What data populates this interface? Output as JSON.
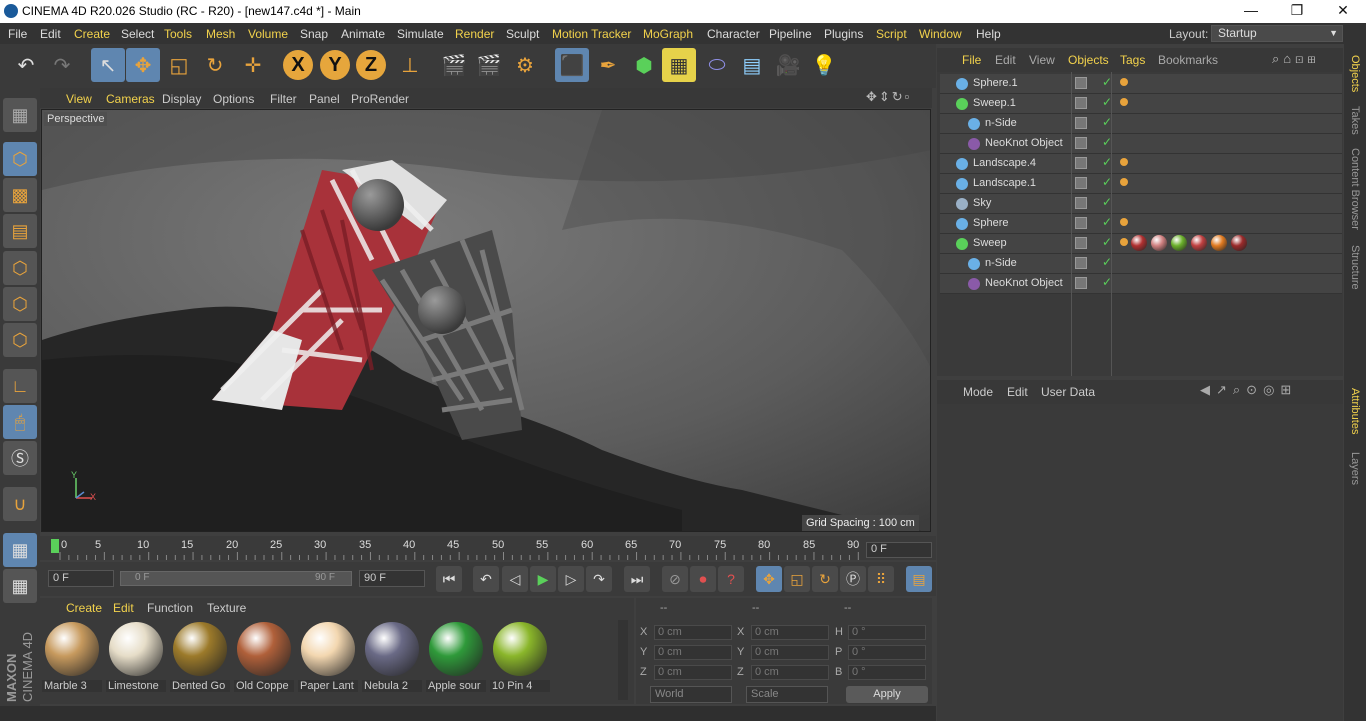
{
  "window": {
    "title": "CINEMA 4D R20.026 Studio (RC - R20) - [new147.c4d *] - Main",
    "minimize": "—",
    "maximize": "❐",
    "close": "✕"
  },
  "menubar": {
    "items": [
      "File",
      "Edit",
      "Create",
      "Select",
      "Tools",
      "Mesh",
      "Volume",
      "Snap",
      "Animate",
      "Simulate",
      "Render",
      "Sculpt",
      "Motion Tracker",
      "MoGraph",
      "Character",
      "Pipeline",
      "Plugins",
      "Script",
      "Window",
      "Help"
    ],
    "layout_label": "Layout:",
    "layout_value": "Startup"
  },
  "toolbar": {
    "axis_x": "X",
    "axis_y": "Y",
    "axis_z": "Z"
  },
  "viewport": {
    "menu": [
      "View",
      "Cameras",
      "Display",
      "Options",
      "Filter",
      "Panel",
      "ProRender"
    ],
    "camera_label": "Perspective",
    "grid_spacing": "Grid Spacing : 100 cm",
    "axis_y": "Y",
    "axis_x": "X"
  },
  "timeline": {
    "ticks": [
      "0",
      "5",
      "10",
      "15",
      "20",
      "25",
      "30",
      "35",
      "40",
      "45",
      "50",
      "55",
      "60",
      "65",
      "70",
      "75",
      "80",
      "85",
      "90"
    ],
    "current_frame": "0 F"
  },
  "transport": {
    "start_frame": "0 F",
    "range_start": "0 F",
    "range_end": "90 F",
    "end_frame": "90 F"
  },
  "materials": {
    "menu": [
      "Create",
      "Edit",
      "Function",
      "Texture"
    ],
    "items": [
      {
        "name": "Marble 3",
        "color": "#c79a5e"
      },
      {
        "name": "Limestone",
        "color": "#e6ddc8"
      },
      {
        "name": "Dented Go",
        "color": "#9c7a2a"
      },
      {
        "name": "Old Coppe",
        "color": "#b0603a"
      },
      {
        "name": "Paper Lant",
        "color": "#f3d7b0"
      },
      {
        "name": "Nebula 2",
        "color": "#6a6a86"
      },
      {
        "name": "Apple sour",
        "color": "#2f9a3a"
      },
      {
        "name": "10 Pin 4",
        "color": "#8ab62a"
      }
    ]
  },
  "coordinates": {
    "headers": [
      "--",
      "--",
      "--"
    ],
    "rows": [
      {
        "l1": "X",
        "v1": "0 cm",
        "l2": "X",
        "v2": "0 cm",
        "l3": "H",
        "v3": "0 °"
      },
      {
        "l1": "Y",
        "v1": "0 cm",
        "l2": "Y",
        "v2": "0 cm",
        "l3": "P",
        "v3": "0 °"
      },
      {
        "l1": "Z",
        "v1": "0 cm",
        "l2": "Z",
        "v2": "0 cm",
        "l3": "B",
        "v3": "0 °"
      }
    ],
    "mode1": "World",
    "mode2": "Scale",
    "apply": "Apply"
  },
  "objects_panel": {
    "menu": [
      "File",
      "Edit",
      "View",
      "Objects",
      "Tags",
      "Bookmarks"
    ],
    "rows": [
      {
        "name": "Sphere.1",
        "indent": 0,
        "icon_color": "#6ab0e6"
      },
      {
        "name": "Sweep.1",
        "indent": 0,
        "icon_color": "#5ad05a"
      },
      {
        "name": "n-Side",
        "indent": 1,
        "icon_color": "#6ab0e6"
      },
      {
        "name": "NeoKnot Object",
        "indent": 1,
        "icon_color": "#8a5aa8"
      },
      {
        "name": "Landscape.4",
        "indent": 0,
        "icon_color": "#6ab0e6"
      },
      {
        "name": "Landscape.1",
        "indent": 0,
        "icon_color": "#6ab0e6"
      },
      {
        "name": "Sky",
        "indent": 0,
        "icon_color": "#9ab0c6"
      },
      {
        "name": "Sphere",
        "indent": 0,
        "icon_color": "#6ab0e6"
      },
      {
        "name": "Sweep",
        "indent": 0,
        "icon_color": "#5ad05a"
      },
      {
        "name": "n-Side",
        "indent": 1,
        "icon_color": "#6ab0e6"
      },
      {
        "name": "NeoKnot Object",
        "indent": 1,
        "icon_color": "#8a5aa8"
      }
    ]
  },
  "attributes_panel": {
    "menu": [
      "Mode",
      "Edit",
      "User Data"
    ]
  },
  "right_tabs": [
    "Objects",
    "Takes",
    "Content Browser",
    "Structure",
    "Attributes",
    "Layers"
  ],
  "brand": {
    "name": "MAXON CINEMA 4D"
  }
}
